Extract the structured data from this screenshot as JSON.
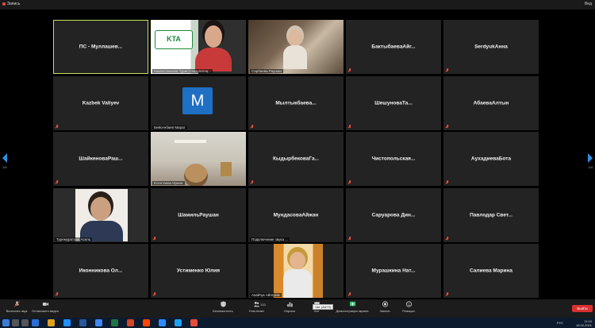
{
  "window": {
    "recording_label": "Запись",
    "view_label": "Вид"
  },
  "tiles": [
    {
      "id": "t1",
      "name": "ПС - Муллашев...",
      "kind": "name",
      "active": true,
      "mic_off": false
    },
    {
      "id": "t2",
      "label": "Казахстанская Туристская ассоц...",
      "kind": "kta",
      "logo_text": "KTA"
    },
    {
      "id": "t3",
      "label": "Сарбаева Раушан",
      "kind": "room"
    },
    {
      "id": "t4",
      "name": "БактыбаеваАйг...",
      "kind": "name",
      "mic_off": true
    },
    {
      "id": "t5",
      "name": "SerdyukАнна",
      "kind": "name",
      "mic_off": true
    },
    {
      "id": "t6",
      "name": "Kazbek Valiyev",
      "kind": "name",
      "mic_off": true
    },
    {
      "id": "t7",
      "label": "Бейсенбаев Марат",
      "kind": "avatar",
      "avatar_letter": "M"
    },
    {
      "id": "t8",
      "name": "Мылтыкбаева...",
      "kind": "name",
      "mic_off": true
    },
    {
      "id": "t9",
      "name": "ШешуноваТа...",
      "kind": "name",
      "mic_off": true
    },
    {
      "id": "t10",
      "name": "АбаеваАлтын",
      "kind": "name",
      "mic_off": true
    },
    {
      "id": "t11",
      "name": "ШайкеноваРаш...",
      "kind": "name",
      "mic_off": true
    },
    {
      "id": "t12",
      "label": "Есентаева Ирина",
      "kind": "ceiling"
    },
    {
      "id": "t13",
      "name": "КыдырбековаГа...",
      "kind": "name",
      "mic_off": true
    },
    {
      "id": "t14",
      "name": "Чистопольская...",
      "kind": "name",
      "mic_off": true
    },
    {
      "id": "t15",
      "name": "АухадиеваБота",
      "kind": "name",
      "mic_off": true
    },
    {
      "id": "t16",
      "label": "Туремуратова Асель",
      "kind": "portrait"
    },
    {
      "id": "t17",
      "name": "ШамильРаушан",
      "kind": "name",
      "mic_off": true
    },
    {
      "id": "t18",
      "name": "МундасоваАйжан",
      "kind": "name",
      "mic_off": true,
      "sub_label": "Подключение звука ..."
    },
    {
      "id": "t19",
      "name": "Саруарова Дин...",
      "kind": "name",
      "mic_off": true
    },
    {
      "id": "t20",
      "name": "Павлодар Свет...",
      "kind": "name",
      "mic_off": true
    },
    {
      "id": "t21",
      "name": "Иконникова Ол...",
      "kind": "name",
      "mic_off": true
    },
    {
      "id": "t22",
      "name": "Устименко Юлия",
      "kind": "name",
      "mic_off": true
    },
    {
      "id": "t23",
      "label": "Акайчук Айгерим",
      "kind": "beach"
    },
    {
      "id": "t24",
      "name": "Мурашкина Нат...",
      "kind": "name",
      "mic_off": true
    },
    {
      "id": "t25",
      "name": "Салиева Марина",
      "kind": "name",
      "mic_off": true
    }
  ],
  "navigation": {
    "page_left": "1/4",
    "page_right": "1/4"
  },
  "toolbar": {
    "mic_label": "Включить звук",
    "video_label": "Остановить видео",
    "security_label": "Безопасность",
    "participants_label": "Участники",
    "participants_count": "133",
    "polls_label": "Опросы",
    "chat_label": "Чат",
    "chat_tooltip": "Чат (Alt+H)",
    "share_label": "Демонстрация экрана",
    "record_label": "Запись",
    "reactions_label": "Реакции",
    "leave_label": "Выйти"
  },
  "taskbar": {
    "time": "11:10",
    "date": "18.02.2021",
    "lang": "РУС"
  },
  "colors": {
    "active_border": "#c5e05b",
    "muted_red": "#e74c3c",
    "leave_red": "#d93030",
    "accent_blue": "#2f8fe0"
  }
}
